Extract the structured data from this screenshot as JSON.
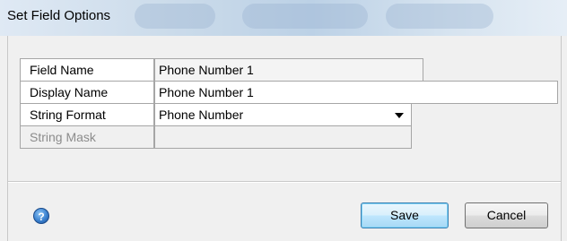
{
  "window": {
    "title": "Set Field Options"
  },
  "fields": [
    {
      "label": "Field Name",
      "value": "Phone Number 1"
    },
    {
      "label": "Display Name",
      "value": "Phone Number 1"
    },
    {
      "label": "String Format",
      "value": "Phone Number"
    },
    {
      "label": "String Mask",
      "value": ""
    }
  ],
  "footer": {
    "help_icon": "help-icon",
    "save_label": "Save",
    "cancel_label": "Cancel"
  },
  "colors": {
    "default_button_border": "#3c7fb1",
    "disabled_text": "#8c8c8c"
  }
}
